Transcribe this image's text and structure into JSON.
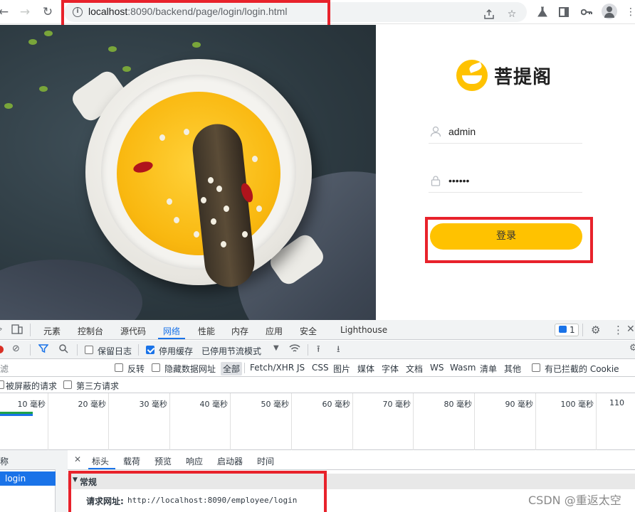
{
  "browser": {
    "url_host": "localhost",
    "url_rest": ":8090/backend/page/login/login.html",
    "icons": [
      "back-icon",
      "forward-icon",
      "reload-icon",
      "info-icon",
      "share-icon",
      "star-icon",
      "flask-icon",
      "sidepanel-icon",
      "key-icon",
      "profile-icon",
      "menu-icon"
    ]
  },
  "login": {
    "brand": "菩提阁",
    "username": "admin",
    "password": "••••••",
    "submit_label": "登录"
  },
  "devtools": {
    "tabs": [
      "元素",
      "控制台",
      "源代码",
      "网络",
      "性能",
      "内存",
      "应用",
      "安全",
      "Lighthouse"
    ],
    "active_tab": "网络",
    "issues_count": "1",
    "toolbar": {
      "preserve_log": "保留日志",
      "disable_cache": "停用缓存",
      "throttling": "已停用节流模式"
    },
    "filter": {
      "placeholder": "滤",
      "invert": "反转",
      "hide_data_urls": "隐藏数据网址",
      "types": [
        "全部",
        "Fetch/XHR",
        "JS",
        "CSS",
        "图片",
        "媒体",
        "字体",
        "文档",
        "WS",
        "Wasm",
        "清单",
        "其他"
      ],
      "blocked_cookies": "有已拦截的 Cookie",
      "blocked_requests": "被屏蔽的请求",
      "third_party": "第三方请求"
    },
    "timeline_ticks": [
      "10 毫秒",
      "20 毫秒",
      "30 毫秒",
      "40 毫秒",
      "50 毫秒",
      "60 毫秒",
      "70 毫秒",
      "80 毫秒",
      "90 毫秒",
      "100 毫秒",
      "110"
    ],
    "request_list": {
      "header": "称",
      "selected": "login"
    },
    "detail_tabs": [
      "标头",
      "载荷",
      "预览",
      "响应",
      "启动器",
      "时间"
    ],
    "active_detail_tab": "标头",
    "general": {
      "title": "常规",
      "request_url_label": "请求网址:",
      "request_url": "http://localhost:8090/employee/login"
    }
  },
  "watermark": "CSDN @重返太空",
  "colors": {
    "accent_yellow": "#ffc200",
    "annotation_red": "#e8222b",
    "devtools_blue": "#1a73e8"
  }
}
